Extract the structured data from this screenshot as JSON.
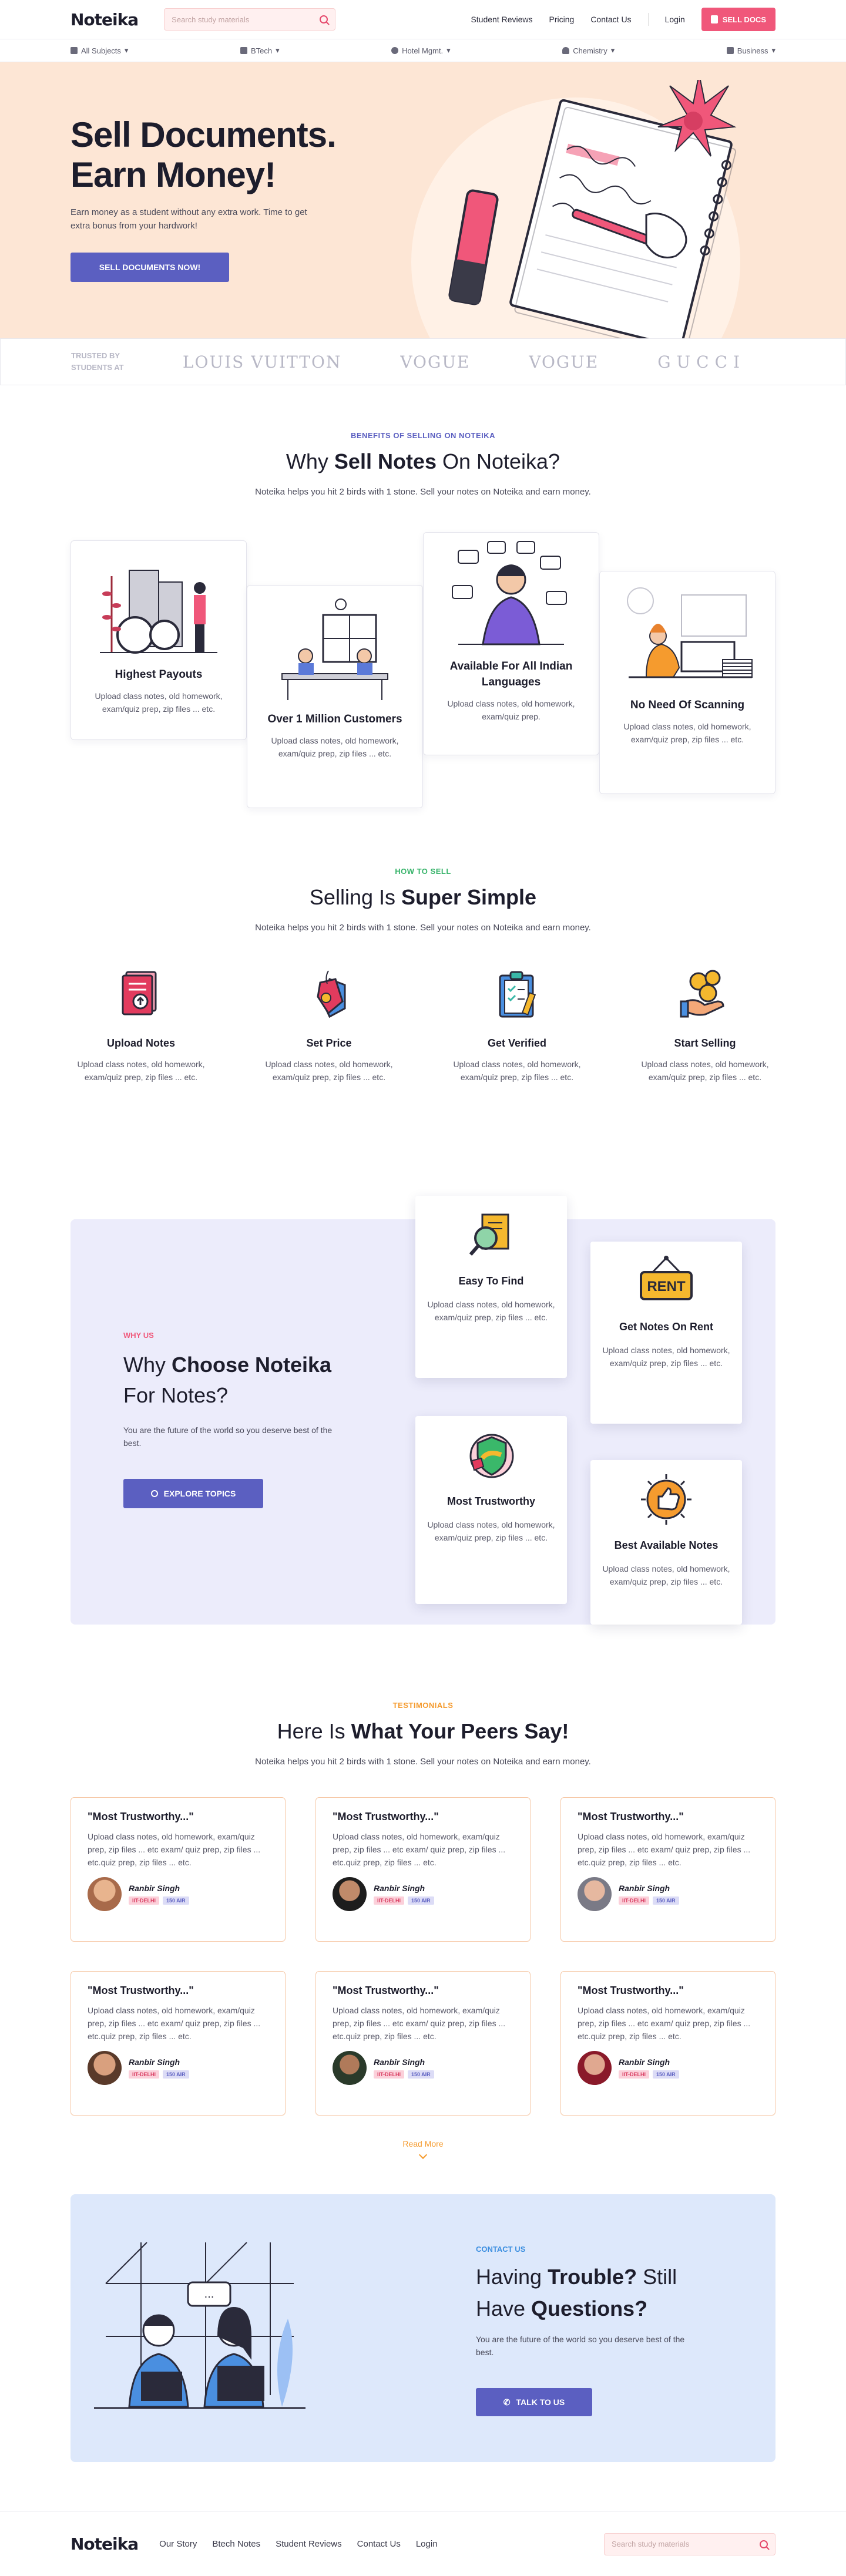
{
  "header": {
    "logo": "Noteika",
    "search_placeholder": "Search study materials",
    "links": [
      "Student Reviews",
      "Pricing",
      "Contact Us"
    ],
    "login": "Login",
    "sell_docs": "SELL DOCS"
  },
  "categories": [
    {
      "label": "All Subjects",
      "icon": "grid-icon"
    },
    {
      "label": "BTech",
      "icon": "book-icon"
    },
    {
      "label": "Hotel Mgmt.",
      "icon": "bulb-icon"
    },
    {
      "label": "Chemistry",
      "icon": "person-icon"
    },
    {
      "label": "Business",
      "icon": "briefcase-icon"
    }
  ],
  "hero": {
    "title_line1": "Sell Documents.",
    "title_line2": "Earn Money!",
    "subtitle": "Earn money as a student without any extra work. Time to get extra bonus from your hardwork!",
    "cta": "SELL DOCUMENTS NOW!"
  },
  "trusted": {
    "label": "TRUSTED BY STUDENTS AT",
    "brands": [
      "LOUIS VUITTON",
      "VOGUE",
      "VOGUE",
      "GUCCI"
    ]
  },
  "benefits": {
    "tag": "BENEFITS OF SELLING ON NOTEIKA",
    "title_pre": "Why ",
    "title_bold": "Sell Notes",
    "title_post": " On Noteika?",
    "subtitle": "Noteika helps you hit 2 birds with 1 stone. Sell your notes on Noteika and earn money.",
    "cards": [
      {
        "title": "Highest Payouts",
        "text": "Upload class notes, old homework, exam/quiz prep, zip files ... etc."
      },
      {
        "title": "Over 1 Million Customers",
        "text": "Upload class notes, old homework, exam/quiz prep, zip files ... etc."
      },
      {
        "title": "Available For All Indian Languages",
        "text": "Upload class notes, old homework, exam/quiz prep."
      },
      {
        "title": "No Need Of Scanning",
        "text": "Upload class notes, old homework, exam/quiz prep, zip files ... etc."
      }
    ]
  },
  "how": {
    "tag": "HOW TO SELL",
    "title_pre": "Selling Is ",
    "title_bold": "Super Simple",
    "subtitle": "Noteika helps you hit 2 birds with 1 stone. Sell your notes on Noteika and earn money.",
    "steps": [
      {
        "title": "Upload Notes",
        "text": "Upload class notes, old homework, exam/quiz prep, zip files ... etc."
      },
      {
        "title": "Set Price",
        "text": "Upload class notes, old homework, exam/quiz prep, zip files ... etc."
      },
      {
        "title": "Get Verified",
        "text": "Upload class notes, old homework, exam/quiz prep, zip files ... etc."
      },
      {
        "title": "Start Selling",
        "text": "Upload class notes, old homework, exam/quiz prep, zip files ... etc."
      }
    ]
  },
  "why": {
    "tag": "WHY US",
    "title_pre": "Why ",
    "title_bold": "Choose Noteika",
    "title_post": " For Notes?",
    "desc": "You are the future of the world so you deserve best of the best.",
    "button": "EXPLORE TOPICS",
    "cards": [
      {
        "title": "Easy To Find",
        "text": "Upload class notes, old homework, exam/quiz prep, zip files ... etc."
      },
      {
        "title": "Get Notes On Rent",
        "text": "Upload class notes, old homework, exam/quiz prep, zip files ... etc.",
        "sign": "RENT"
      },
      {
        "title": "Most Trustworthy",
        "text": "Upload class notes, old homework, exam/quiz prep, zip files ... etc."
      },
      {
        "title": "Best Available Notes",
        "text": "Upload class notes, old homework, exam/quiz prep, zip files ... etc."
      }
    ]
  },
  "testimonials": {
    "tag": "TESTIMONIALS",
    "title_pre": "Here Is ",
    "title_bold": "What Your Peers Say!",
    "subtitle": "Noteika helps you hit 2 birds with 1 stone. Sell your notes on Noteika and earn money.",
    "items": [
      {
        "quote": "\"Most Trustworthy...\"",
        "text": "Upload class notes, old homework, exam/quiz prep, zip files ... etc exam/ quiz prep, zip files ... etc.quiz prep, zip files ... etc.",
        "name": "Ranbir Singh",
        "badge1": "IIT-DELHI",
        "badge2": "150 AIR"
      },
      {
        "quote": "\"Most Trustworthy...\"",
        "text": "Upload class notes, old homework, exam/quiz prep, zip files ... etc exam/ quiz prep, zip files ... etc.quiz prep, zip files ... etc.",
        "name": "Ranbir Singh",
        "badge1": "IIT-DELHI",
        "badge2": "150 AIR"
      },
      {
        "quote": "\"Most Trustworthy...\"",
        "text": "Upload class notes, old homework, exam/quiz prep, zip files ... etc exam/ quiz prep, zip files ... etc.quiz prep, zip files ... etc.",
        "name": "Ranbir Singh",
        "badge1": "IIT-DELHI",
        "badge2": "150 AIR"
      },
      {
        "quote": "\"Most Trustworthy...\"",
        "text": "Upload class notes, old homework, exam/quiz prep, zip files ... etc exam/ quiz prep, zip files ... etc.quiz prep, zip files ... etc.",
        "name": "Ranbir Singh",
        "badge1": "IIT-DELHI",
        "badge2": "150 AIR"
      },
      {
        "quote": "\"Most Trustworthy...\"",
        "text": "Upload class notes, old homework, exam/quiz prep, zip files ... etc exam/ quiz prep, zip files ... etc.quiz prep, zip files ... etc.",
        "name": "Ranbir Singh",
        "badge1": "IIT-DELHI",
        "badge2": "150 AIR"
      },
      {
        "quote": "\"Most Trustworthy...\"",
        "text": "Upload class notes, old homework, exam/quiz prep, zip files ... etc exam/ quiz prep, zip files ... etc.quiz prep, zip files ... etc.",
        "name": "Ranbir Singh",
        "badge1": "IIT-DELHI",
        "badge2": "150 AIR"
      }
    ],
    "read_more": "Read More"
  },
  "contact": {
    "tag": "CONTACT US",
    "title_pre": "Having ",
    "title_bold1": "Trouble?",
    "title_mid": " Still Have ",
    "title_bold2": "Questions?",
    "desc": "You are the future of the world so you deserve best of the best.",
    "button": "TALK TO US"
  },
  "footer": {
    "logo": "Noteika",
    "links": [
      "Our Story",
      "Btech Notes",
      "Student Reviews",
      "Contact Us",
      "Login"
    ],
    "search_placeholder": "Search study materials"
  },
  "colors": {
    "primary": "#5b5fc1",
    "accent": "#f0577a",
    "hero_bg": "#fde6d5",
    "why_bg": "#ececfb",
    "contact_bg": "#dde8fb",
    "testimonial_tag": "#f59b2e",
    "how_tag": "#37b36a"
  }
}
